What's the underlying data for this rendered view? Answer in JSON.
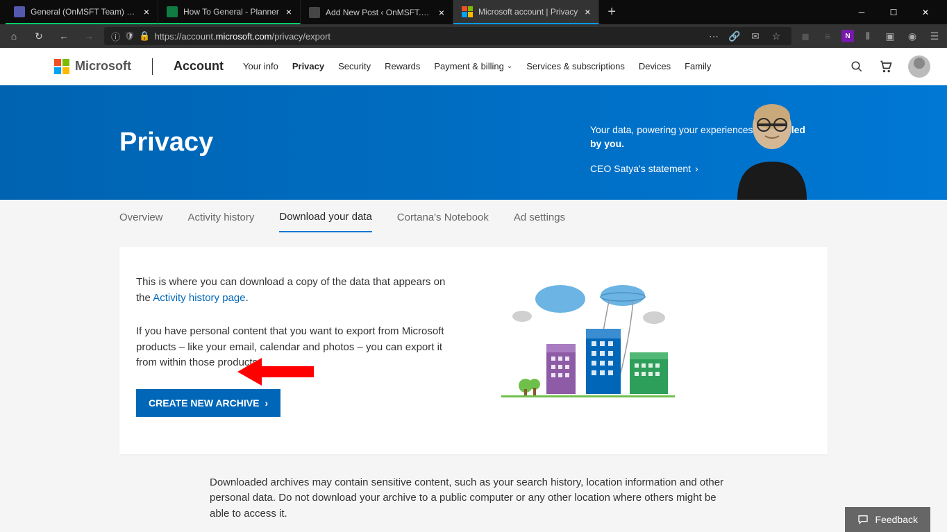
{
  "browser": {
    "tabs": [
      {
        "title": "General (OnMSFT Team) | Micro",
        "active": false,
        "icon_bg": "#5558af"
      },
      {
        "title": "How To General - Planner",
        "active": false,
        "icon_bg": "#107c41"
      },
      {
        "title": "Add New Post ‹ OnMSFT.com — W",
        "active": false,
        "icon_bg": "#464646"
      },
      {
        "title": "Microsoft account | Privacy",
        "active": true,
        "icon_bg": "#fff"
      }
    ],
    "url_prefix": "https://account.",
    "url_domain": "microsoft.com",
    "url_path": "/privacy/export"
  },
  "header": {
    "brand": "Microsoft",
    "section": "Account",
    "nav": [
      {
        "label": "Your info",
        "active": false,
        "chevron": false
      },
      {
        "label": "Privacy",
        "active": true,
        "chevron": false
      },
      {
        "label": "Security",
        "active": false,
        "chevron": false
      },
      {
        "label": "Rewards",
        "active": false,
        "chevron": false
      },
      {
        "label": "Payment & billing",
        "active": false,
        "chevron": true
      },
      {
        "label": "Services & subscriptions",
        "active": false,
        "chevron": false
      },
      {
        "label": "Devices",
        "active": false,
        "chevron": false
      },
      {
        "label": "Family",
        "active": false,
        "chevron": false
      }
    ]
  },
  "hero": {
    "title": "Privacy",
    "copy_pre": "Your data, powering your experiences, ",
    "copy_strong": "controlled by you.",
    "ceo_link": "CEO Satya's statement"
  },
  "subtabs": [
    {
      "label": "Overview",
      "active": false
    },
    {
      "label": "Activity history",
      "active": false
    },
    {
      "label": "Download your data",
      "active": true
    },
    {
      "label": "Cortana's Notebook",
      "active": false
    },
    {
      "label": "Ad settings",
      "active": false
    }
  ],
  "card": {
    "intro_pre": "This is where you can download a copy of the data that appears on the ",
    "intro_link": "Activity history page",
    "intro_post": ".",
    "export_note": "If you have personal content that you want to export from Microsoft products – like your email, calendar and photos – you can export it from within those products.",
    "button": "CREATE NEW ARCHIVE"
  },
  "footer_note": "Downloaded archives may contain sensitive content, such as your search history, location information and other personal data. Do not download your archive to a public computer or any other location where others might be able to access it.",
  "feedback": "Feedback"
}
